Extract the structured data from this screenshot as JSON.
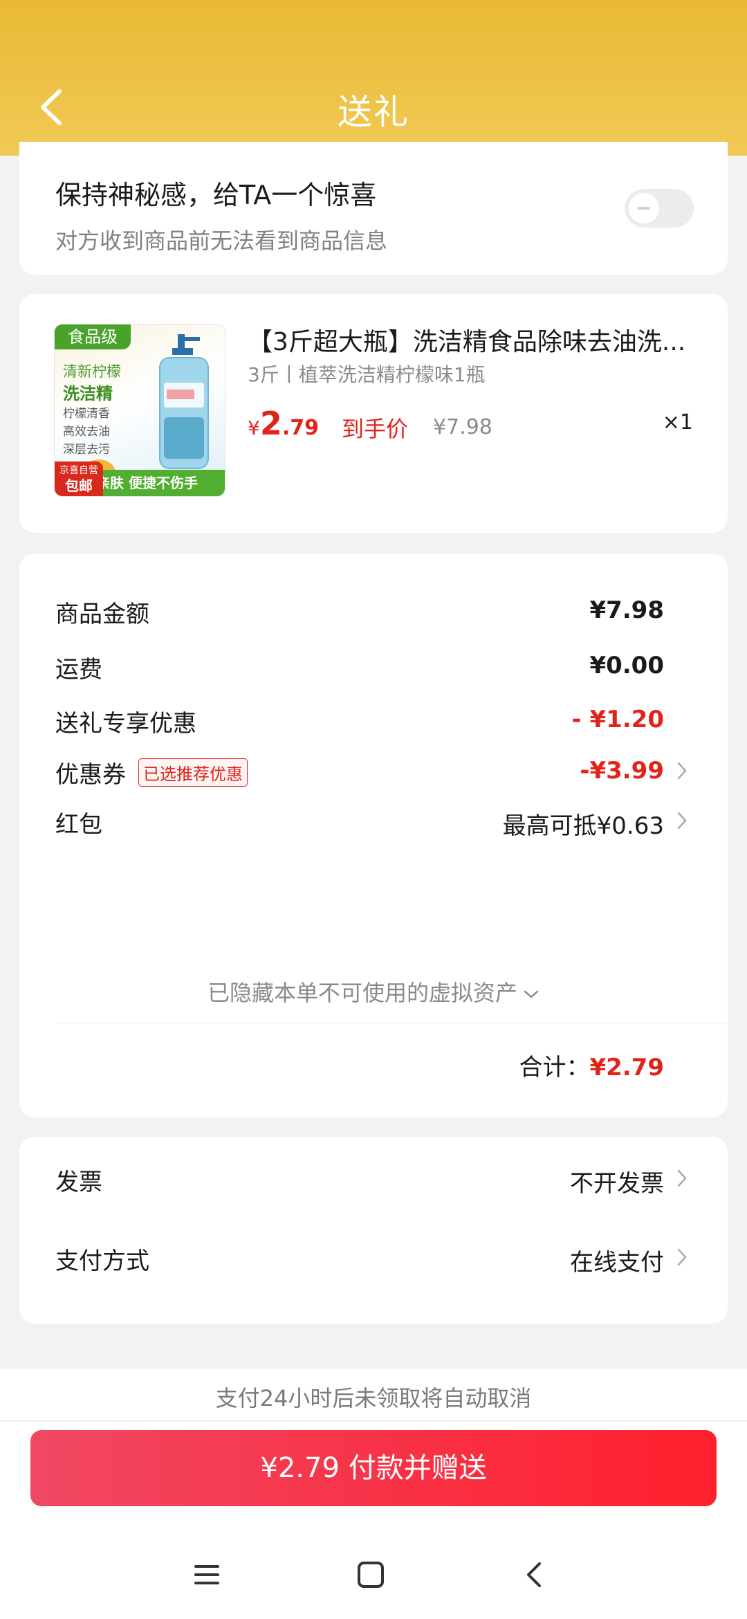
{
  "header": {
    "title": "送礼"
  },
  "surprise": {
    "title": "保持神秘感，给TA一个惊喜",
    "subtitle": "对方收到商品前无法看到商品信息",
    "toggle_on": false
  },
  "product": {
    "thumb": {
      "tag": "食品级",
      "line1": "清新柠檬",
      "line2": "洗洁精",
      "line3": "柠檬清香",
      "line4": "高效去油",
      "line5": "深层去污",
      "badge_top": "京喜自营",
      "badge_bottom": "包邮",
      "footer": "亲肤 便捷不伤手"
    },
    "title": "【3斤超大瓶】洗洁精食品除味去油洗...",
    "spec": "3斤丨植萃洗洁精柠檬味1瓶",
    "price_currency": "¥",
    "price_int": "2",
    "price_dec": ".79",
    "price_label": "到手价",
    "original_price": "¥7.98",
    "quantity": "×1"
  },
  "summary": {
    "goods_label": "商品金额",
    "goods_value": "¥7.98",
    "shipping_label": "运费",
    "shipping_value": "¥0.00",
    "gift_discount_label": "送礼专享优惠",
    "gift_discount_value": "- ¥1.20",
    "coupon_label": "优惠券",
    "coupon_tag": "已选推荐优惠",
    "coupon_value": "-¥3.99",
    "redpacket_label": "红包",
    "redpacket_value": "最高可抵¥0.63",
    "hidden_note": "已隐藏本单不可使用的虚拟资产",
    "total_label": "合计：",
    "total_value": "¥2.79"
  },
  "extra": {
    "invoice_label": "发票",
    "invoice_value": "不开发票",
    "payment_label": "支付方式",
    "payment_value": "在线支付"
  },
  "notice": "支付24小时后未领取将自动取消",
  "pay_button": "¥2.79 付款并赠送",
  "colors": {
    "accent_red": "#e2231a",
    "header_yellow": "#f1c955"
  }
}
